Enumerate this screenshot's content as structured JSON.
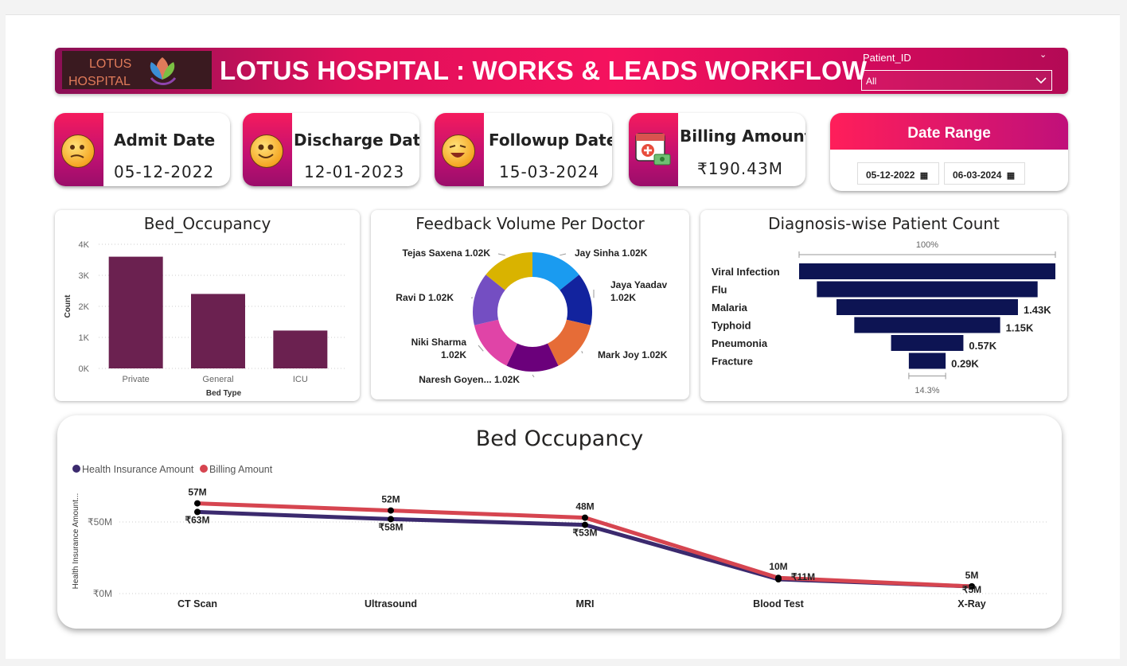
{
  "header": {
    "logo_line1": "LOTUS",
    "logo_line2": "HOSPITAL",
    "title": "LOTUS HOSPITAL : WORKS & LEADS WORKFLOW",
    "slicer_label": "Patient_ID",
    "slicer_value": "All",
    "brand_color": "#e0105a"
  },
  "kpis": [
    {
      "label": "Admit Date",
      "value": "05-12-2022",
      "icon": "confused-face-icon"
    },
    {
      "label": "Discharge Date",
      "value": "12-01-2023",
      "icon": "smiling-face-icon"
    },
    {
      "label": "Followup Date",
      "value": "15-03-2024",
      "icon": "laughing-face-icon"
    },
    {
      "label": "Billing Amount",
      "value": "₹190.43M",
      "icon": "medical-billing-icon"
    }
  ],
  "date_range": {
    "label": "Date Range",
    "start": "05-12-2022",
    "end": "06-03-2024",
    "icon": "calendar-icon"
  },
  "bed_chart": {
    "title": "Bed_Occupancy",
    "chart_data": {
      "type": "bar",
      "categories": [
        "Private",
        "General",
        "ICU"
      ],
      "values": [
        3600,
        2400,
        1220
      ],
      "ylim": [
        0,
        4000
      ],
      "yticks": [
        "0K",
        "1K",
        "2K",
        "3K",
        "4K"
      ],
      "xlabel": "Bed Type",
      "ylabel": "Count",
      "color": "#6b2150"
    }
  },
  "feedback_chart": {
    "title": "Feedback Volume Per Doctor",
    "chart_data": {
      "type": "pie",
      "donut": true,
      "slices": [
        {
          "name": "Jay Sinha",
          "label": "Jay Sinha 1.02K",
          "value": 1020,
          "color": "#1a9bf0"
        },
        {
          "name": "Jaya Yaadav",
          "label": "Jaya Yaadav 1.02K",
          "value": 1020,
          "color": "#12239e"
        },
        {
          "name": "Mark Joy",
          "label": "Mark Joy 1.02K",
          "value": 1020,
          "color": "#e66c37"
        },
        {
          "name": "Naresh Goyen...",
          "label": "Naresh Goyen... 1.02K",
          "value": 1020,
          "color": "#6b007b"
        },
        {
          "name": "Niki Sharma",
          "label": "Niki Sharma 1.02K",
          "value": 1020,
          "color": "#e044a7"
        },
        {
          "name": "Ravi D",
          "label": "Ravi D 1.02K",
          "value": 1020,
          "color": "#744ec2"
        },
        {
          "name": "Tejas Saxena",
          "label": "Tejas Saxena 1.02K",
          "value": 1020,
          "color": "#d9b300"
        }
      ]
    }
  },
  "diagnosis_chart": {
    "title": "Diagnosis-wise Patient Count",
    "top_pct": "100%",
    "bottom_pct": "14.3%",
    "chart_data": {
      "type": "bar",
      "orientation": "funnel",
      "categories": [
        "Viral Infection",
        "Flu",
        "Malaria",
        "Typhoid",
        "Pneumonia",
        "Fracture"
      ],
      "values": [
        2020,
        1740,
        1430,
        1150,
        570,
        290
      ],
      "value_labels": [
        "",
        "",
        "1.43K",
        "1.15K",
        "0.57K",
        "0.29K"
      ],
      "color": "#0d1453"
    }
  },
  "line_chart": {
    "title": "Bed Occupancy",
    "legend": [
      "Health Insurance Amount",
      "Billing Amount"
    ],
    "ylabel": "Health Insurance Amount...",
    "yticks": [
      "₹0M",
      "₹50M"
    ],
    "chart_data": {
      "type": "line",
      "categories": [
        "CT Scan",
        "Ultrasound",
        "MRI",
        "Blood Test",
        "X-Ray"
      ],
      "series": [
        {
          "name": "Health Insurance Amount",
          "values": [
            57,
            52,
            48,
            10,
            5
          ],
          "labels": [
            "57M",
            "52M",
            "48M",
            "10M",
            "5M"
          ],
          "color": "#3b2a6e"
        },
        {
          "name": "Billing Amount",
          "values": [
            63,
            58,
            53,
            11,
            5
          ],
          "labels": [
            "₹63M",
            "₹58M",
            "₹53M",
            "₹11M",
            "₹5M"
          ],
          "color": "#d64550"
        }
      ],
      "ylim": [
        0,
        90
      ]
    }
  }
}
